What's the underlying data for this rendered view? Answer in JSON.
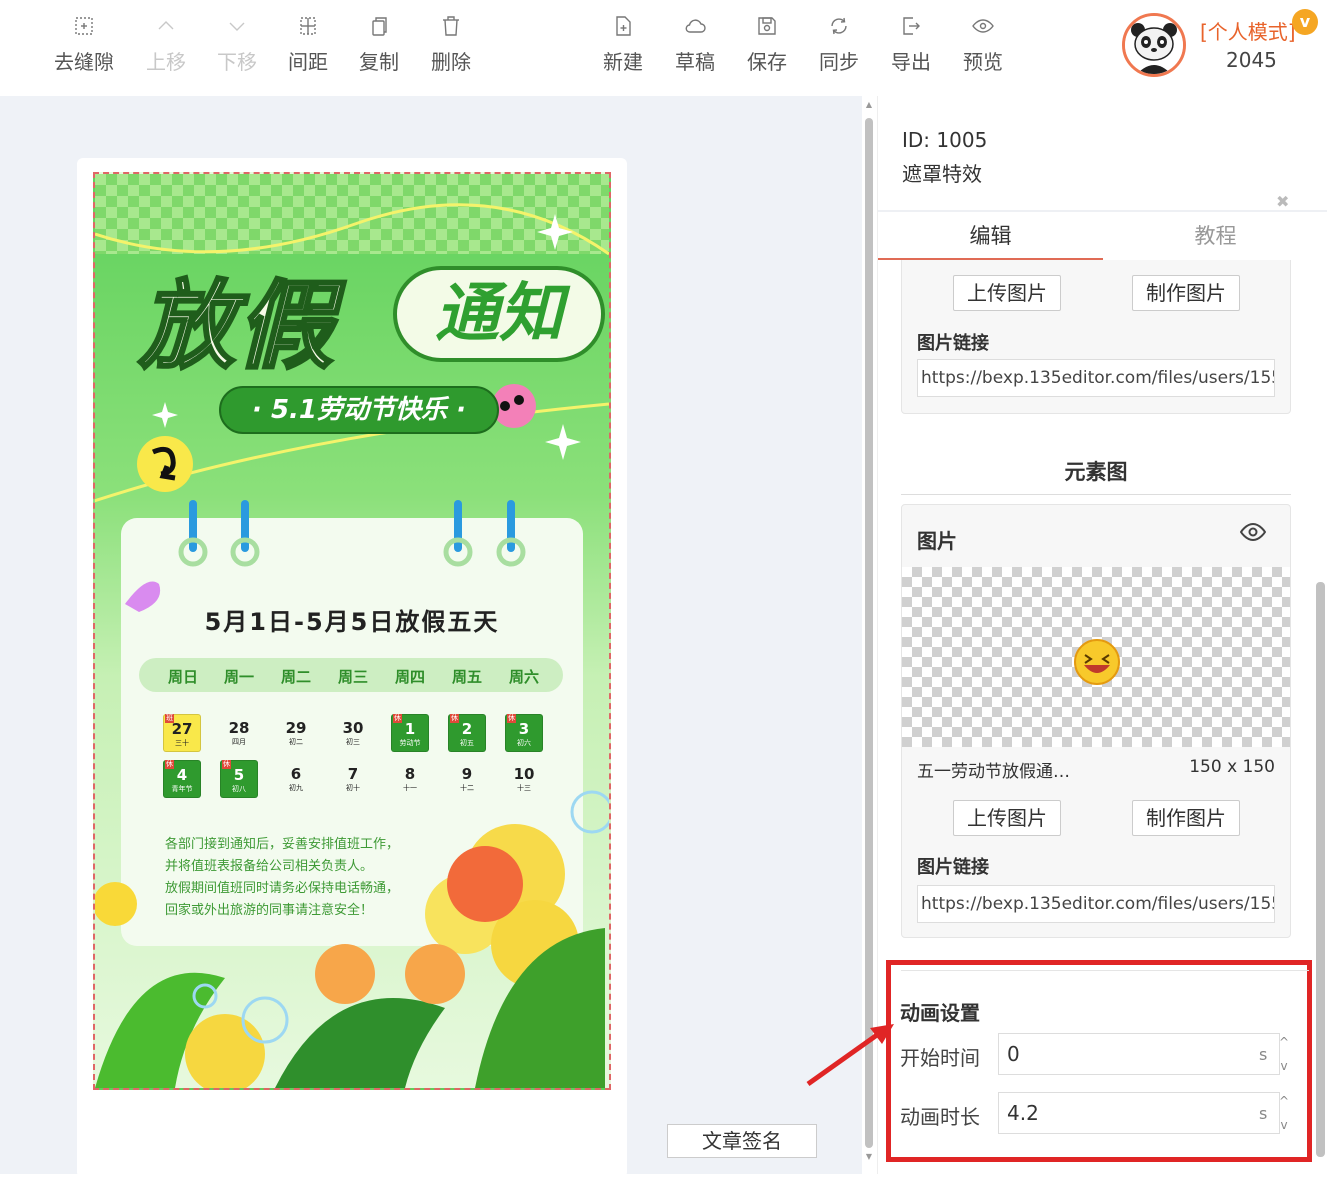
{
  "toolbar": {
    "left": [
      {
        "label": "去缝隙",
        "icon": "remove-gap-icon",
        "disabled": false
      },
      {
        "label": "上移",
        "icon": "chevron-up-icon",
        "disabled": true
      },
      {
        "label": "下移",
        "icon": "chevron-down-icon",
        "disabled": true
      },
      {
        "label": "间距",
        "icon": "spacing-icon",
        "disabled": false
      },
      {
        "label": "复制",
        "icon": "copy-icon",
        "disabled": false
      },
      {
        "label": "删除",
        "icon": "trash-icon",
        "disabled": false
      }
    ],
    "right": [
      {
        "label": "新建",
        "icon": "new-file-icon"
      },
      {
        "label": "草稿",
        "icon": "cloud-icon"
      },
      {
        "label": "保存",
        "icon": "save-icon"
      },
      {
        "label": "同步",
        "icon": "sync-icon"
      },
      {
        "label": "导出",
        "icon": "export-icon"
      },
      {
        "label": "预览",
        "icon": "eye-icon"
      }
    ]
  },
  "user": {
    "mode": "[个人模式]",
    "badge": "v",
    "count": "2045"
  },
  "poster": {
    "title_main": "放假",
    "title_tag": "通知",
    "subtitle": "· 5.1劳动节快乐 ·",
    "headline": "5月1日-5月5日放假五天",
    "weekdays": [
      "周日",
      "周一",
      "周二",
      "周三",
      "周四",
      "周五",
      "周六"
    ],
    "week1": [
      {
        "day": "27",
        "sub": "三十",
        "style": "work",
        "flag": "班"
      },
      {
        "day": "28",
        "sub": "四月",
        "style": "plain",
        "flag": ""
      },
      {
        "day": "29",
        "sub": "初二",
        "style": "plain",
        "flag": ""
      },
      {
        "day": "30",
        "sub": "初三",
        "style": "plain",
        "flag": ""
      },
      {
        "day": "1",
        "sub": "劳动节",
        "style": "rest",
        "flag": "休"
      },
      {
        "day": "2",
        "sub": "初五",
        "style": "rest",
        "flag": "休"
      },
      {
        "day": "3",
        "sub": "初六",
        "style": "rest",
        "flag": "休"
      }
    ],
    "week2": [
      {
        "day": "4",
        "sub": "青年节",
        "style": "rest",
        "flag": "休"
      },
      {
        "day": "5",
        "sub": "初八",
        "style": "rest",
        "flag": "休"
      },
      {
        "day": "6",
        "sub": "初九",
        "style": "plain",
        "flag": ""
      },
      {
        "day": "7",
        "sub": "初十",
        "style": "plain",
        "flag": ""
      },
      {
        "day": "8",
        "sub": "十一",
        "style": "plain",
        "flag": ""
      },
      {
        "day": "9",
        "sub": "十二",
        "style": "plain",
        "flag": ""
      },
      {
        "day": "10",
        "sub": "十三",
        "style": "plain",
        "flag": ""
      }
    ],
    "notice": [
      "各部门接到通知后，妥善安排值班工作，",
      "并将值班表报备给公司相关负责人。",
      "放假期间值班同时请务必保持电话畅通，",
      "回家或外出旅游的同事请注意安全！"
    ]
  },
  "canvas": {
    "signature_button": "文章签名"
  },
  "panel": {
    "id_text": "ID: 1005",
    "name": "遮罩特效",
    "tabs": [
      "编辑",
      "教程"
    ],
    "upload_label": "上传图片",
    "make_label": "制作图片",
    "link_label": "图片链接",
    "link_value": "https://bexp.135editor.com/files/users/1552/1",
    "element_section_title": "元素图",
    "image_block_title": "图片",
    "image_name": "五一劳动节放假通…",
    "image_size": "150 x 150",
    "animation": {
      "title": "动画设置",
      "start_label": "开始时间",
      "start_value": "0",
      "duration_label": "动画时长",
      "duration_value": "4.2",
      "unit": "s"
    }
  },
  "colors": {
    "accent": "#e06b55",
    "highlight_border": "#e02525",
    "poster_green": "#3fb83a",
    "mode_orange": "#e8632b"
  }
}
